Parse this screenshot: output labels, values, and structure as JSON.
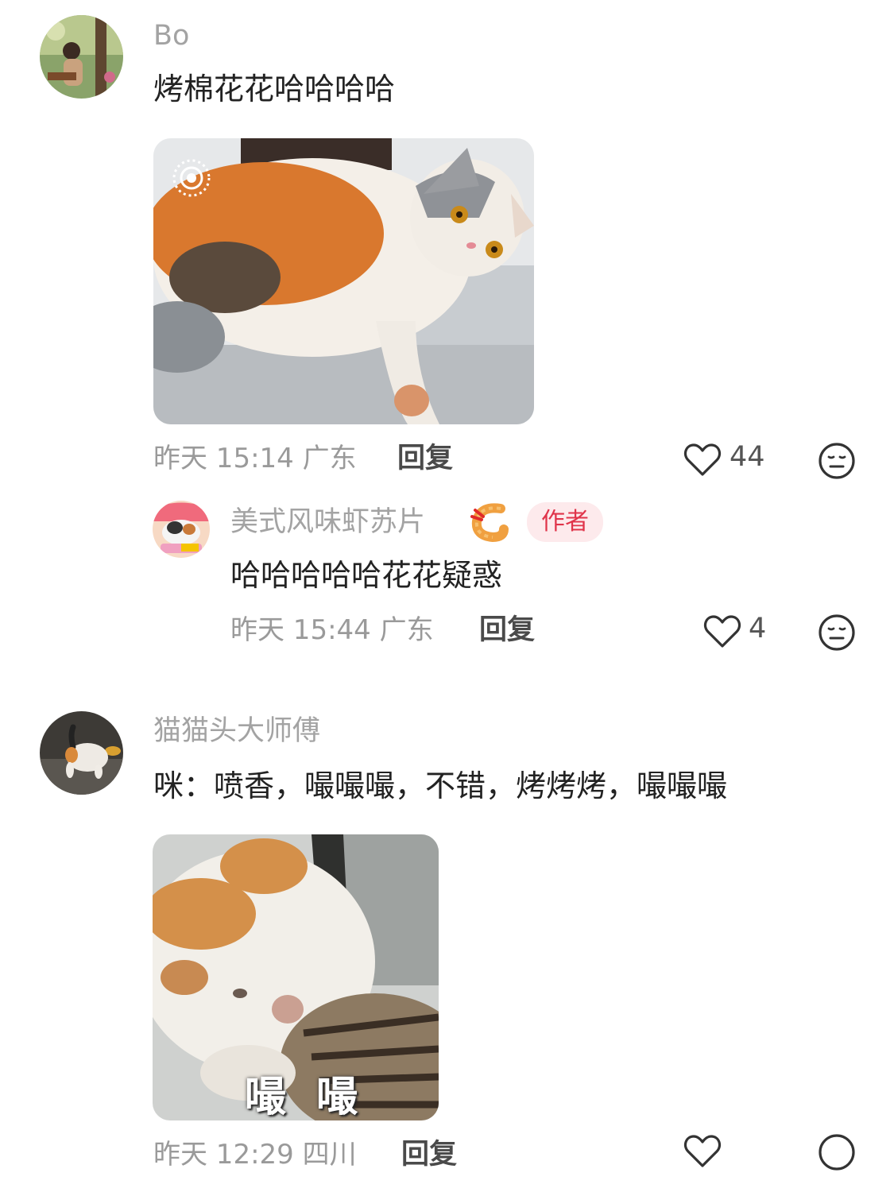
{
  "comments": [
    {
      "username": "Bo",
      "text": "烤棉花花哈哈哈哈",
      "meta": "昨天 15:14 广东",
      "reply_label": "回复",
      "likes": "44",
      "reply": {
        "username": "美式风味虾苏片",
        "badge": "作者",
        "text": "哈哈哈哈哈花花疑惑",
        "meta": "昨天 15:44 广东",
        "reply_label": "回复",
        "likes": "4"
      }
    },
    {
      "username": "猫猫头大师傅",
      "text": "咪：喷香，嘬嘬嘬，不错，烤烤烤，嘬嘬嘬",
      "image_caption": "嘬 嘬",
      "meta": "昨天 12:29 四川",
      "reply_label": "回复"
    }
  ],
  "icons": {
    "like": "heart-outline-icon",
    "dislike": "meh-face-icon",
    "live_photo": "live-photo-icon",
    "emoji": "shrimp-emoji-icon"
  },
  "colors": {
    "badge_bg": "#fdeaec",
    "badge_text": "#e0344a",
    "username": "#a3a3a3",
    "meta": "#9a9a9a"
  }
}
